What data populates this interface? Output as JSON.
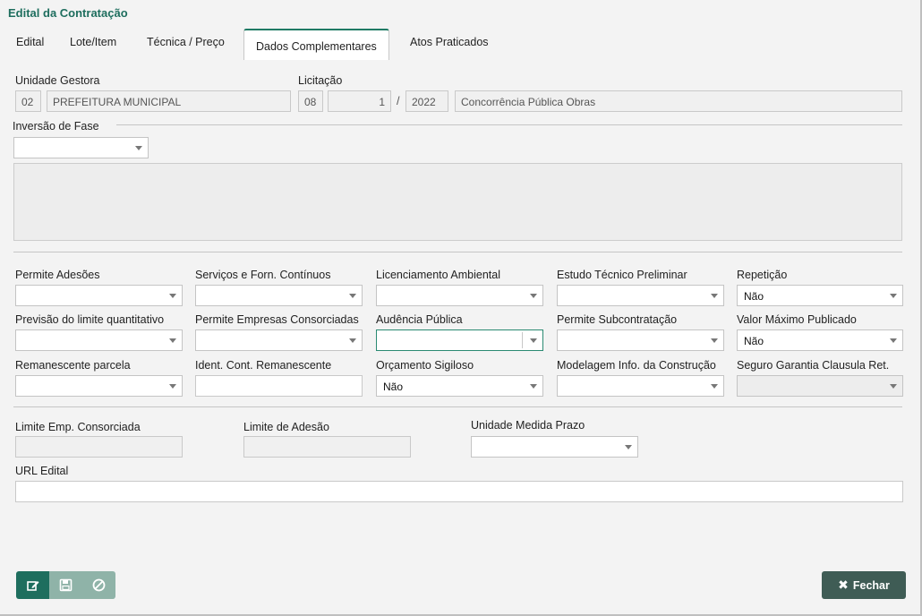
{
  "window": {
    "title": "Edital da Contratação"
  },
  "tabs": [
    {
      "label": "Edital"
    },
    {
      "label": "Lote/Item"
    },
    {
      "label": "Técnica / Preço"
    },
    {
      "label": "Dados Complementares",
      "active": true
    },
    {
      "label": "Atos Praticados"
    }
  ],
  "header": {
    "unidade_gestora_label": "Unidade Gestora",
    "unidade_code": "02",
    "unidade_name": "PREFEITURA MUNICIPAL",
    "licitacao_label": "Licitação",
    "licitacao_mod": "08",
    "licitacao_num": "1",
    "licitacao_sep": "/",
    "licitacao_ano": "2022",
    "licitacao_desc": "Concorrência Pública Obras"
  },
  "inversao": {
    "label": "Inversão de Fase",
    "value": ""
  },
  "fields": {
    "permite_adesoes": {
      "label": "Permite Adesões",
      "value": ""
    },
    "servicos_continuos": {
      "label": "Serviços e Forn. Contínuos",
      "value": ""
    },
    "licenciamento": {
      "label": "Licenciamento Ambiental",
      "value": ""
    },
    "estudo_tecnico": {
      "label": "Estudo Técnico Preliminar",
      "value": ""
    },
    "repeticao": {
      "label": "Repetição",
      "value": "Não"
    },
    "previsao_limite": {
      "label": "Previsão do limite quantitativo",
      "value": ""
    },
    "empresas_consorciadas": {
      "label": "Permite Empresas Consorciadas",
      "value": ""
    },
    "audiencia_publica": {
      "label": "Audência Pública",
      "value": ""
    },
    "subcontratacao": {
      "label": "Permite Subcontratação",
      "value": ""
    },
    "valor_maximo": {
      "label": "Valor Máximo Publicado",
      "value": "Não"
    },
    "remanescente_parcela": {
      "label": "Remanescente parcela",
      "value": ""
    },
    "ident_remanescente": {
      "label": "Ident. Cont. Remanescente",
      "value": ""
    },
    "orcamento_sigiloso": {
      "label": "Orçamento Sigiloso",
      "value": "Não"
    },
    "modelagem": {
      "label": "Modelagem Info. da Construção",
      "value": ""
    },
    "seguro_garantia": {
      "label": "Seguro Garantia Clausula Ret.",
      "value": ""
    },
    "limite_consorciada": {
      "label": "Limite Emp. Consorciada",
      "value": ""
    },
    "limite_adesao": {
      "label": "Limite de Adesão",
      "value": ""
    },
    "unidade_prazo": {
      "label": "Unidade Medida Prazo",
      "value": ""
    },
    "url_edital": {
      "label": "URL Edital",
      "value": ""
    }
  },
  "footer": {
    "fechar_label": "Fechar",
    "icons": [
      "edit-icon",
      "save-icon",
      "cancel-icon"
    ]
  },
  "colors": {
    "primary": "#1e6e5e",
    "faded": "#8fb3a8",
    "close": "#3f5c55"
  }
}
